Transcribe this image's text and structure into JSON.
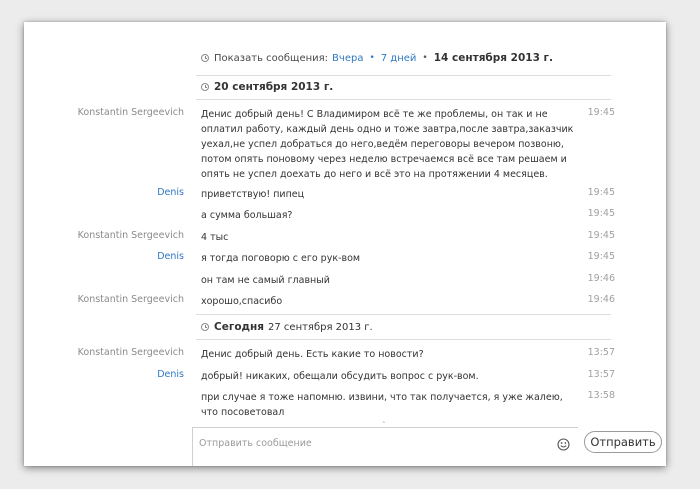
{
  "history_bar": {
    "label": "Показать сообщения:",
    "yesterday": "Вчера",
    "seven_days": "7 дней",
    "date_link": "14 сентября 2013 г."
  },
  "sections": [
    {
      "date_bold": "20 сентября 2013 г.",
      "date_rest": ""
    },
    {
      "date_bold": "Сегодня",
      "date_rest": "27 сентября 2013 г."
    }
  ],
  "messages": [
    {
      "sender": "Konstantin Sergeevich",
      "text": "Денис добрый день! С Владимиром всё те же проблемы, он так и не оплатил работу, каждый день одно и тоже завтра,после завтра,заказчик уехал,не успел добраться до него,ведём переговоры вечером позвоню, потом опять поновому через неделю встречаемся всё все там решаем и опять не успел доехать до него и всё это на протяжении 4 месяцев.",
      "time": "19:45"
    },
    {
      "sender": "Denis",
      "text": "приветствую! пипец",
      "time": "19:45"
    },
    {
      "sender": "",
      "text": "а сумма большая?",
      "time": "19:45"
    },
    {
      "sender": "Konstantin Sergeevich",
      "text": "4 тыс",
      "time": "19:45"
    },
    {
      "sender": "Denis",
      "text": "я тогда поговорю с его рук-вом",
      "time": "19:45"
    },
    {
      "sender": "",
      "text": "он там не самый главный",
      "time": "19:46"
    },
    {
      "sender": "Konstantin Sergeevich",
      "text": "хорошо,спасибо",
      "time": "19:46"
    },
    {
      "sender": "Konstantin Sergeevich",
      "text": "Денис добрый день. Есть какие то новости?",
      "time": "13:57"
    },
    {
      "sender": "Denis",
      "text": "добрый! никаких, обещали обсудить вопрос с рук-вом.",
      "time": "13:57"
    },
    {
      "sender": "",
      "text": "при случае я тоже напомню. извини, что так получается, я уже жалею, что посоветовал",
      "time": "13:58"
    }
  ],
  "composer": {
    "placeholder": "Отправить сообщение",
    "send_label": "Отправить",
    "smiley_icon": "emoticon-icon",
    "scroll_glyph": "˄"
  }
}
